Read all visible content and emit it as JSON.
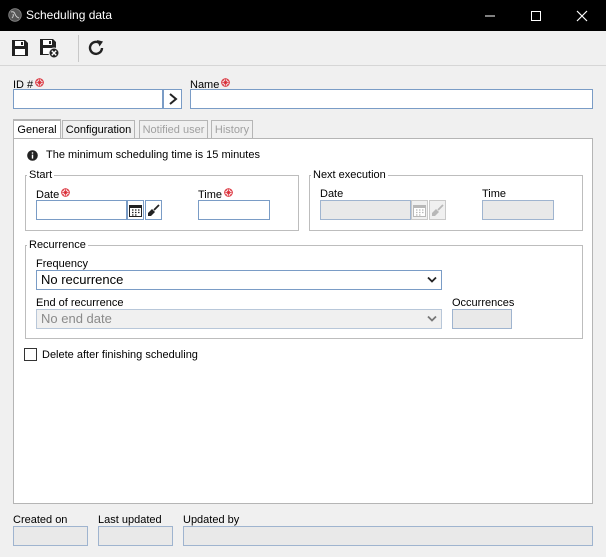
{
  "window": {
    "title": "Scheduling data",
    "icons": [
      "globe-icon",
      "minimize-icon",
      "maximize-icon",
      "close-icon"
    ]
  },
  "toolbar": {
    "buttons": [
      "save-icon",
      "save-and-close-icon",
      "refresh-icon"
    ]
  },
  "header": {
    "id_label": "ID #",
    "id_value": "",
    "name_label": "Name",
    "name_value": ""
  },
  "tabs": [
    {
      "label": "General",
      "state": "active"
    },
    {
      "label": "Configuration",
      "state": "enabled"
    },
    {
      "label": "Notified user",
      "state": "disabled"
    },
    {
      "label": "History",
      "state": "disabled"
    }
  ],
  "general": {
    "info_text": "The minimum scheduling time is 15 minutes",
    "start": {
      "legend": "Start",
      "date_label": "Date",
      "date_value": "",
      "time_label": "Time",
      "time_value": ""
    },
    "next_execution": {
      "legend": "Next execution",
      "date_label": "Date",
      "time_label": "Time"
    },
    "recurrence": {
      "legend": "Recurrence",
      "frequency_label": "Frequency",
      "frequency_value": "No recurrence",
      "end_label": "End of recurrence",
      "end_value": "No end date",
      "occurrences_label": "Occurrences",
      "occurrences_value": ""
    },
    "delete_after_label": "Delete after finishing scheduling",
    "delete_after_checked": false
  },
  "footer": {
    "created_on_label": "Created on",
    "last_updated_label": "Last updated",
    "updated_by_label": "Updated by"
  },
  "colors": {
    "titlebar": "#000000",
    "required": "#d9232e",
    "active_tab_accent": "#2e9f3e",
    "input_border": "#7a9cc6"
  }
}
